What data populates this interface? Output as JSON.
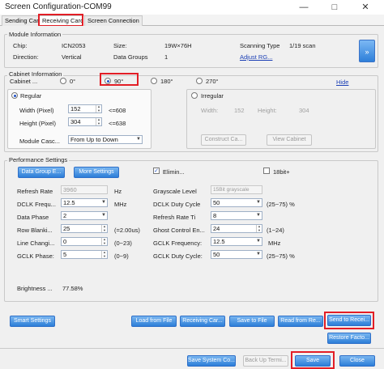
{
  "window": {
    "title": "Screen Configuration-COM99"
  },
  "tabs": [
    "Sending Card",
    "Receiving Card",
    "Screen Connection"
  ],
  "module_info": {
    "title": "Module Information",
    "chip_label": "Chip:",
    "chip_value": "ICN2053",
    "size_label": "Size:",
    "size_value": "19W×76H",
    "scan_label": "Scanning Type",
    "scan_value": "1/19 scan",
    "direction_label": "Direction:",
    "direction_value": "Vertical",
    "groups_label": "Data Groups",
    "groups_value": "1",
    "adjust_link": "Adjust RG...",
    "next_button": "»"
  },
  "cabinet": {
    "title": "Cabinet Information",
    "rotation_label": "Cabinet ...",
    "rotations": [
      "0°",
      "90°",
      "180°",
      "270°"
    ],
    "hide_link": "Hide",
    "regular_label": "Regular",
    "width_label": "Width (Pixel)",
    "width_value": "152",
    "width_limit": "<=608",
    "height_label": "Height (Pixel)",
    "height_value": "304",
    "height_limit": "<=638",
    "cascade_label": "Module Casc...",
    "cascade_value": "From Up to Down",
    "irregular_label": "Irregular",
    "irr_width_label": "Width:",
    "irr_width_value": "152",
    "irr_height_label": "Height:",
    "irr_height_value": "304",
    "construct_button": "Construct Ca...",
    "view_button": "View Cabinet"
  },
  "performance": {
    "title": "Performance Settings",
    "data_group_button": "Data Group E...",
    "more_settings_button": "More Settings",
    "elimin_label": "Elimin...",
    "bit18_label": "18bit+",
    "refresh_label": "Refresh Rate",
    "refresh_value": "3960",
    "refresh_unit": "Hz",
    "grayscale_label": "Grayscale Level",
    "grayscale_value": "15Bit grayscale",
    "dclk_freq_label": "DCLK Frequ...",
    "dclk_freq_value": "12.5",
    "dclk_freq_unit": "MHz",
    "dclk_duty_label": "DCLK Duty Cycle",
    "dclk_duty_value": "50",
    "dclk_duty_range": "(25~75) %",
    "data_phase_label": "Data Phase",
    "data_phase_value": "2",
    "refresh_ti_label": "Refresh Rate Ti",
    "refresh_ti_value": "8",
    "row_blank_label": "Row Blanki...",
    "row_blank_value": "25",
    "row_blank_hint": "(=2.00us)",
    "ghost_label": "Ghost Control En...",
    "ghost_value": "24",
    "ghost_range": "(1~24)",
    "line_change_label": "Line Changi...",
    "line_change_value": "0",
    "line_change_range": "(0~23)",
    "gclk_freq_label": "GCLK Frequency:",
    "gclk_freq_value": "12.5",
    "gclk_freq_unit": "MHz",
    "gclk_phase_label": "GCLK Phase:",
    "gclk_phase_value": "5",
    "gclk_phase_range": "(0~9)",
    "gclk_duty_label": "GCLK Duty Cycle:",
    "gclk_duty_value": "50",
    "gclk_duty_range": "(25~75) %",
    "brightness_label": "Brightness ...",
    "brightness_value": "77.58%"
  },
  "actions": {
    "smart": "Smart Settings",
    "load": "Load from File",
    "receiving": "Receiving Car...",
    "save_file": "Save to File",
    "read": "Read from Re...",
    "send": "Send to Recei...",
    "restore": "Restore Facto..."
  },
  "footer": {
    "save_system": "Save System Co...",
    "backup": "Back Up Termi...",
    "save": "Save",
    "close": "Close"
  },
  "colors": {
    "accent": "#2c7ed8",
    "highlight": "#e21e26"
  }
}
